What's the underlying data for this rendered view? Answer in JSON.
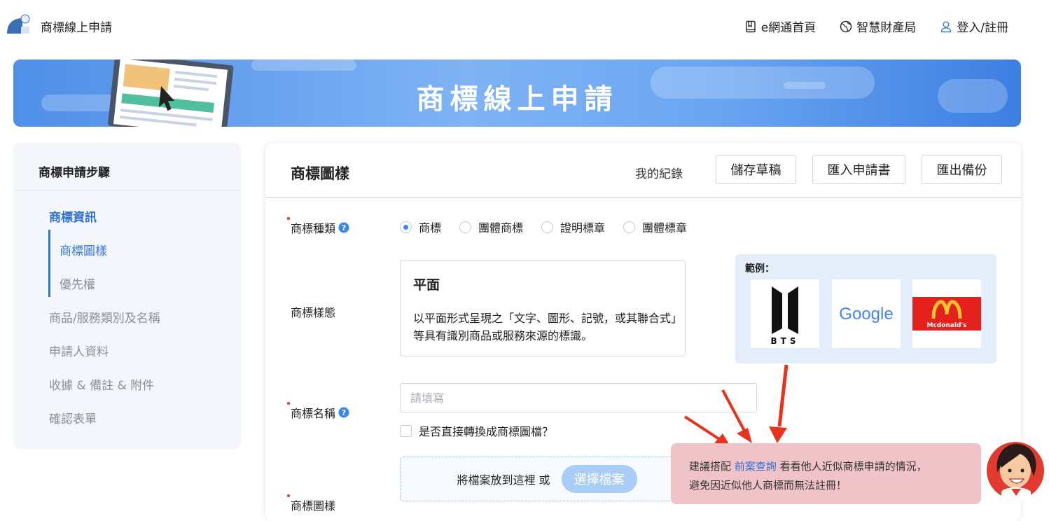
{
  "header": {
    "app_title": "商標線上申請",
    "nav": [
      {
        "label": "e網通首頁",
        "icon": "book-icon"
      },
      {
        "label": "智慧財產局",
        "icon": "globe-icon"
      },
      {
        "label": "登入/註冊",
        "icon": "user-icon"
      }
    ]
  },
  "banner": {
    "title": "商標線上申請"
  },
  "sidebar": {
    "title": "商標申請步驟",
    "steps": [
      {
        "label": "商標資訊",
        "state": "active"
      },
      {
        "label": "商標圖樣",
        "state": "current-sub"
      },
      {
        "label": "優先權",
        "state": "sub"
      },
      {
        "label": "商品/服務類別及名稱",
        "state": "inactive"
      },
      {
        "label": "申請人資料",
        "state": "inactive"
      },
      {
        "label": "收據 & 備註 & 附件",
        "state": "inactive"
      },
      {
        "label": "確認表單",
        "state": "inactive"
      }
    ]
  },
  "panel": {
    "title": "商標圖樣",
    "my_records": "我的紀錄",
    "buttons": {
      "save_draft": "儲存草稿",
      "import": "匯入申請書",
      "export": "匯出備份"
    },
    "type_label": "商標種類",
    "type_options": [
      {
        "label": "商標",
        "checked": true
      },
      {
        "label": "團體商標",
        "checked": false
      },
      {
        "label": "證明標章",
        "checked": false
      },
      {
        "label": "團體標章",
        "checked": false
      }
    ],
    "style_label": "商標樣態",
    "style_card": {
      "title": "平面",
      "desc": "以平面形式呈現之「文字、圖形、記號，或其聯合式」等具有識別商品或服務來源的標識。"
    },
    "example": {
      "label": "範例：",
      "logos": [
        "BTS",
        "Google",
        "Mcdonald's"
      ]
    },
    "name_label": "商標名稱",
    "name_placeholder": "請填寫",
    "convert_checkbox": "是否直接轉換成商標圖檔？",
    "image_label": "商標圖樣",
    "drop_text": "將檔案放到這裡 或",
    "choose_file": "選擇檔案"
  },
  "tip": {
    "prefix": "建議搭配",
    "link": "前案查詢",
    "suffix": "看看他人近似商標申請的情況，",
    "line2": "避免因近似他人商標而無法註冊！"
  },
  "colors": {
    "accent": "#2f6fd6",
    "tip_bg": "#f0c3c8",
    "banner": "#5d9bef"
  }
}
